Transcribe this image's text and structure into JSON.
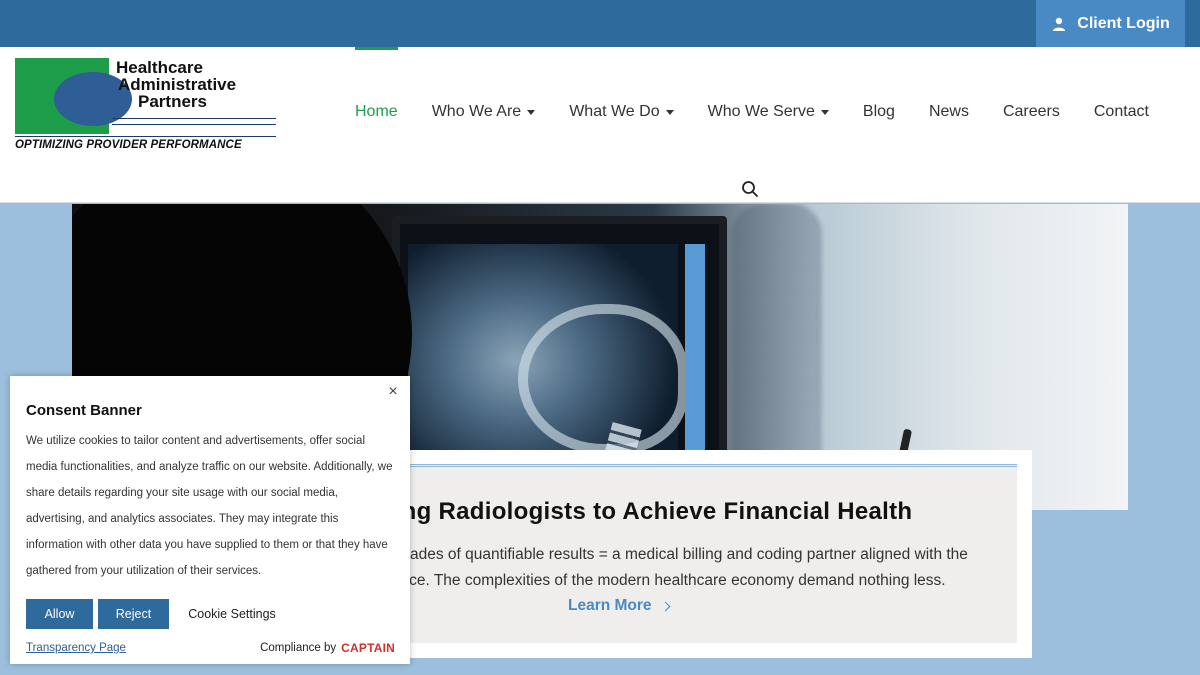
{
  "topbar": {
    "client_login": "Client Login"
  },
  "logo": {
    "line1": "Healthcare",
    "line2": "Administrative",
    "line3": "Partners",
    "tagline": "OPTIMIZING PROVIDER PERFORMANCE",
    "colors": {
      "green": "#1e9e4a",
      "blue": "#2f5d95"
    }
  },
  "nav": {
    "items": [
      {
        "label": "Home",
        "active": true,
        "dropdown": false
      },
      {
        "label": "Who We Are",
        "dropdown": true
      },
      {
        "label": "What We Do",
        "dropdown": true
      },
      {
        "label": "Who We Serve",
        "dropdown": true
      },
      {
        "label": "Blog",
        "dropdown": false
      },
      {
        "label": "News",
        "dropdown": false
      },
      {
        "label": "Careers",
        "dropdown": false
      },
      {
        "label": "Contact",
        "dropdown": false
      }
    ],
    "search_icon": "search-icon"
  },
  "hero": {
    "title": "ring Radiologists to Achieve Financial Health",
    "text_line1": "decades of quantifiable results = a medical billing and coding partner aligned with the",
    "text_line2": "actice. The complexities of the modern healthcare economy demand nothing less.",
    "link": "Learn More"
  },
  "consent": {
    "title": "Consent Banner",
    "body": "We utilize cookies to tailor content and advertisements, offer social media functionalities, and analyze traffic on our website. Additionally, we share details regarding your site usage with our social media, advertising, and analytics associates. They may integrate this information with other data you have supplied to them or that they have gathered from your utilization of their services.",
    "allow": "Allow",
    "reject": "Reject",
    "settings": "Cookie Settings",
    "transparency": "Transparency Page",
    "compliance_by": "Compliance by",
    "captain": "CAPTAIN",
    "close": "×"
  },
  "colors": {
    "topbar": "#2f6a9c",
    "accent_blue": "#4a8ac4",
    "accent_green": "#1e9e4a",
    "page_bg": "#9bbfdd"
  }
}
